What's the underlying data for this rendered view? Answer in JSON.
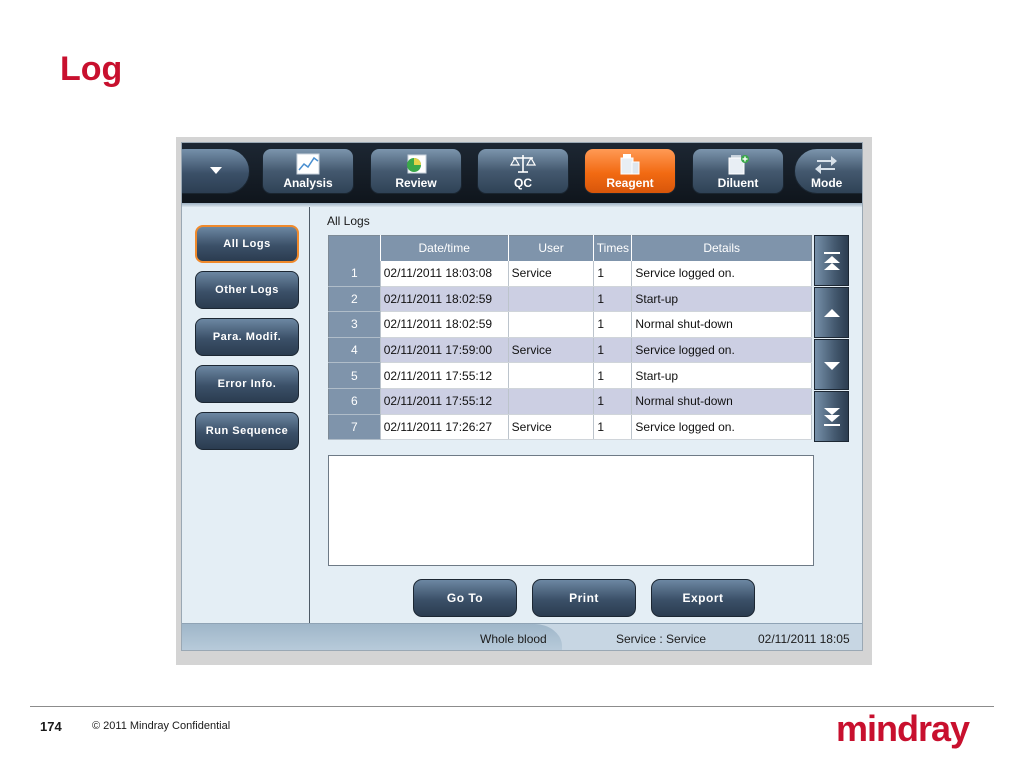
{
  "slide": {
    "title": "Log",
    "page_number": "174",
    "copyright": "© 2011 Mindray Confidential",
    "logo_text": "mindray"
  },
  "colors": {
    "title_red": "#c8102e",
    "active_tab_orange": "#f26a12",
    "table_header": "#7f94ab",
    "alt_row": "#cccfe3"
  },
  "toolbar": {
    "menu_icon": "chevron-down-icon",
    "tabs": [
      {
        "label": "Analysis",
        "icon": "chart-icon"
      },
      {
        "label": "Review",
        "icon": "review-icon"
      },
      {
        "label": "QC",
        "icon": "scale-icon"
      },
      {
        "label": "Reagent",
        "icon": "reagent-icon",
        "active": true
      },
      {
        "label": "Diluent",
        "icon": "diluent-icon"
      },
      {
        "label": "Mode",
        "icon": "swap-arrows-icon"
      }
    ]
  },
  "sidebar": {
    "items": [
      {
        "label": "All  Logs",
        "active": true
      },
      {
        "label": "Other  Logs"
      },
      {
        "label": "Para.  Modif."
      },
      {
        "label": "Error  Info."
      },
      {
        "label": "Run  Sequence"
      }
    ]
  },
  "main": {
    "section_title": "All  Logs",
    "columns": [
      "",
      "Date/time",
      "User",
      "Times",
      "Details"
    ],
    "rows": [
      {
        "no": "1",
        "datetime": "02/11/2011  18:03:08",
        "user": "Service",
        "times": "1",
        "details": "Service  logged  on."
      },
      {
        "no": "2",
        "datetime": "02/11/2011  18:02:59",
        "user": "",
        "times": "1",
        "details": "Start-up"
      },
      {
        "no": "3",
        "datetime": "02/11/2011  18:02:59",
        "user": "",
        "times": "1",
        "details": "Normal  shut-down"
      },
      {
        "no": "4",
        "datetime": "02/11/2011  17:59:00",
        "user": "Service",
        "times": "1",
        "details": "Service  logged  on."
      },
      {
        "no": "5",
        "datetime": "02/11/2011  17:55:12",
        "user": "",
        "times": "1",
        "details": "Start-up"
      },
      {
        "no": "6",
        "datetime": "02/11/2011  17:55:12",
        "user": "",
        "times": "1",
        "details": "Normal  shut-down"
      },
      {
        "no": "7",
        "datetime": "02/11/2011  17:26:27",
        "user": "Service",
        "times": "1",
        "details": "Service  logged  on."
      }
    ],
    "scroll_icons": [
      "first-page-icon",
      "page-up-icon",
      "page-down-icon",
      "last-page-icon"
    ],
    "buttons": {
      "goto": "Go  To",
      "print": "Print",
      "export": "Export"
    }
  },
  "status": {
    "mode": "Whole  blood",
    "user": "Service  :  Service",
    "datetime": "02/11/2011  18:05"
  }
}
